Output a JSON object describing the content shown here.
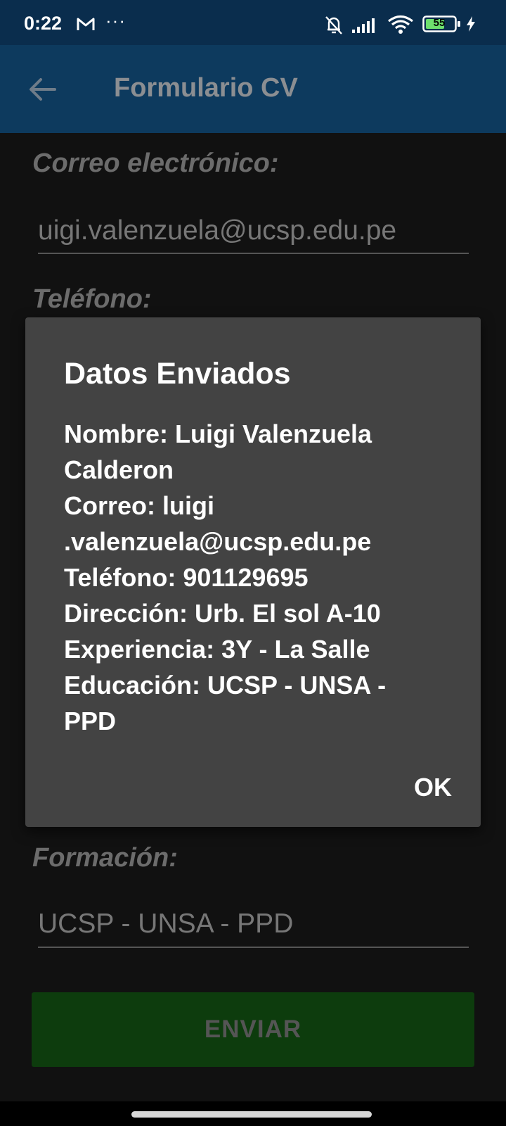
{
  "status_bar": {
    "time": "0:22",
    "overflow": "···",
    "battery": "55",
    "icons": [
      "mail-icon",
      "bell-off-icon",
      "signal-icon",
      "wifi-icon",
      "battery-icon",
      "charging-bolt-icon"
    ]
  },
  "app_bar": {
    "title": "Formulario CV",
    "back_icon": "arrow-left-icon"
  },
  "form": {
    "email_label": "Correo electrónico:",
    "email_value": "uigi.valenzuela@ucsp.edu.pe",
    "phone_label": "Teléfono:",
    "formation_label": "Formación:",
    "formation_value": "UCSP - UNSA - PPD",
    "send_label": "ENVIAR"
  },
  "dialog": {
    "title": "Datos Enviados",
    "lines": [
      "Nombre: Luigi Valenzuela",
      "Calderon",
      "Correo: luigi",
      ".valenzuela@ucsp.edu.pe",
      "Teléfono: 901129695",
      "Dirección: Urb. El sol A-10",
      "Experiencia: 3Y - La Salle",
      "Educación: UCSP - UNSA -",
      "PPD"
    ],
    "ok_label": "OK"
  },
  "colors": {
    "status_bar": "#0a2d4d",
    "app_bar": "#0d3a5e",
    "dialog": "#434343",
    "send_button": "#0d3c0d"
  }
}
